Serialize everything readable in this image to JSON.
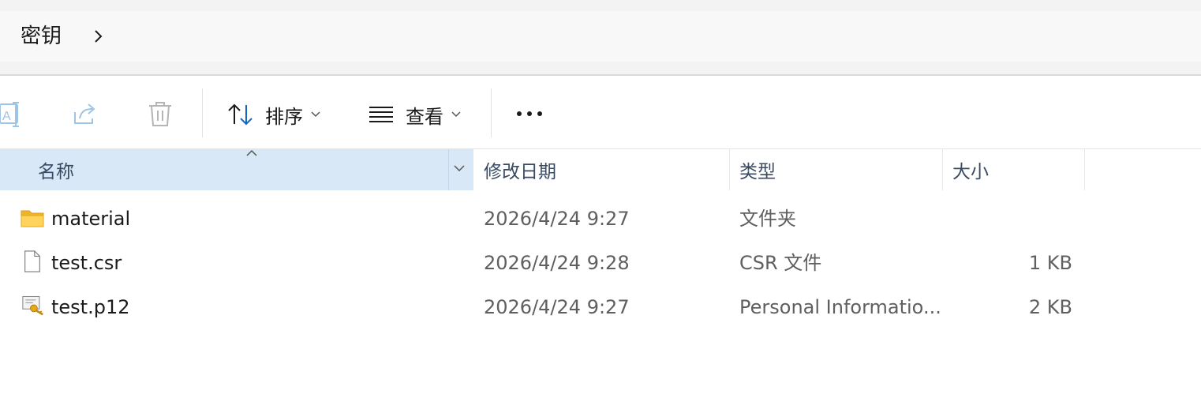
{
  "breadcrumb": {
    "current": "密钥"
  },
  "toolbar": {
    "sort_label": "排序",
    "view_label": "查看"
  },
  "columns": {
    "name": "名称",
    "modified": "修改日期",
    "type": "类型",
    "size": "大小"
  },
  "files": [
    {
      "name": "material",
      "modified": "2026/4/24 9:27",
      "type": "文件夹",
      "size": "",
      "icon": "folder-icon"
    },
    {
      "name": "test.csr",
      "modified": "2026/4/24 9:28",
      "type": "CSR 文件",
      "size": "1 KB",
      "icon": "file-icon"
    },
    {
      "name": "test.p12",
      "modified": "2026/4/24 9:27",
      "type": "Personal Informatio...",
      "size": "2 KB",
      "icon": "certificate-icon"
    }
  ]
}
